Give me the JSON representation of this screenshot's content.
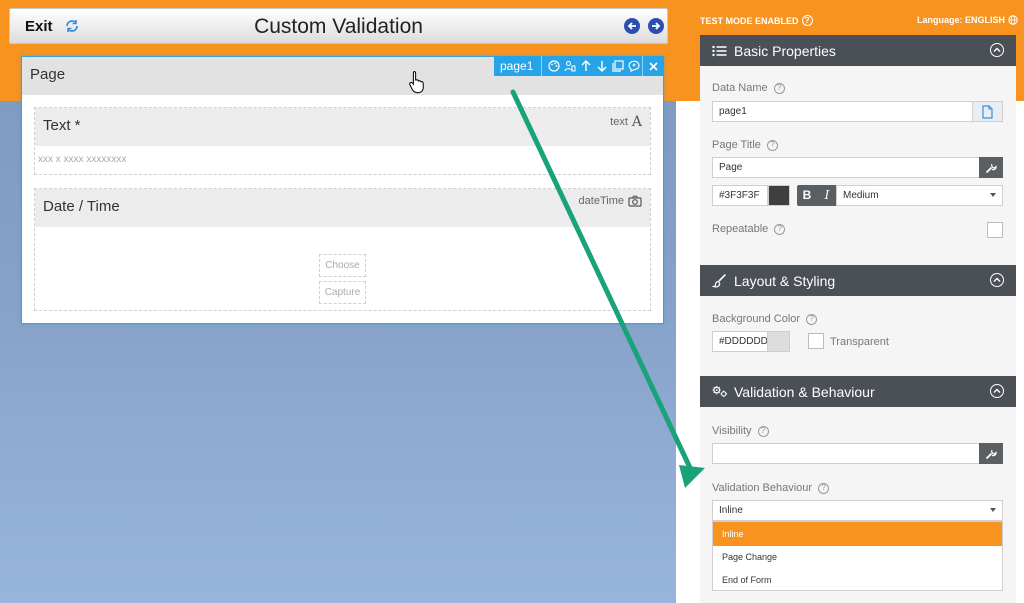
{
  "canvas": {
    "exit_label": "Exit",
    "title": "Custom Validation",
    "page": {
      "label": "Page"
    },
    "toolbar": {
      "name": "page1"
    },
    "fields": [
      {
        "label": "Text *",
        "type": "text",
        "placeholder": "xxx x xxxx xxxxxxxx"
      },
      {
        "label": "Date / Time",
        "type": "dateTime",
        "buttons": [
          "Choose",
          "Capture"
        ]
      }
    ]
  },
  "topbar": {
    "test_mode": "TEST MODE ENABLED",
    "language": "Language: ENGLISH"
  },
  "basic": {
    "header": "Basic Properties",
    "data_name_label": "Data Name",
    "data_name_value": "page1",
    "page_title_label": "Page Title",
    "page_title_value": "Page",
    "color_value": "#3F3F3F",
    "bold_label": "B",
    "italic_label": "I",
    "size_value": "Medium",
    "repeatable_label": "Repeatable"
  },
  "layout": {
    "header": "Layout & Styling",
    "bg_color_label": "Background Color",
    "bg_color_value": "#DDDDDD",
    "transparent_label": "Transparent"
  },
  "validation": {
    "header": "Validation & Behaviour",
    "visibility_label": "Visibility",
    "visibility_value": "",
    "behaviour_label": "Validation Behaviour",
    "behaviour_value": "Inline",
    "options": [
      "Inline",
      "Page Change",
      "End of Form"
    ]
  },
  "colors": {
    "accent": "#f7931e",
    "toolbar_blue": "#27a3e8",
    "section_header": "#4a5056",
    "arrow": "#1aa37a"
  }
}
